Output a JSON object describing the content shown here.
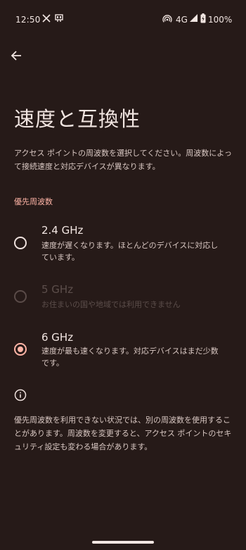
{
  "status_bar": {
    "time": "12:50",
    "network": "4G",
    "battery": "100%",
    "icons": [
      "x-app-icon",
      "notification-icon",
      "hotspot-icon",
      "signal-icon",
      "battery-charging-icon"
    ]
  },
  "header": {
    "back_icon": "arrow-left-icon",
    "title": "速度と互換性"
  },
  "description": "アクセス ポイントの周波数を選択してください。周波数によって接続速度と対応デバイスが異なります。",
  "section": {
    "label": "優先周波数"
  },
  "options": [
    {
      "title": "2.4 GHz",
      "description": "速度が遅くなります。ほとんどのデバイスに対応しています。",
      "selected": false,
      "enabled": true
    },
    {
      "title": "5 GHz",
      "description": "お住まいの国や地域では利用できません",
      "selected": false,
      "enabled": false
    },
    {
      "title": "6 GHz",
      "description": "速度が最も速くなります。対応デバイスはまだ少数です。",
      "selected": true,
      "enabled": true
    }
  ],
  "footer": {
    "icon": "info-icon",
    "text": "優先周波数を利用できない状況では、別の周波数を使用することがあります。周波数を変更すると、アクセス ポイントのセキュリティ設定も変わる場合があります。"
  },
  "colors": {
    "background": "#261a18",
    "accent": "#ffb4a6",
    "text_primary": "#f2e6e2",
    "text_secondary": "#d9c8c3",
    "text_disabled": "#5c4e4b"
  }
}
